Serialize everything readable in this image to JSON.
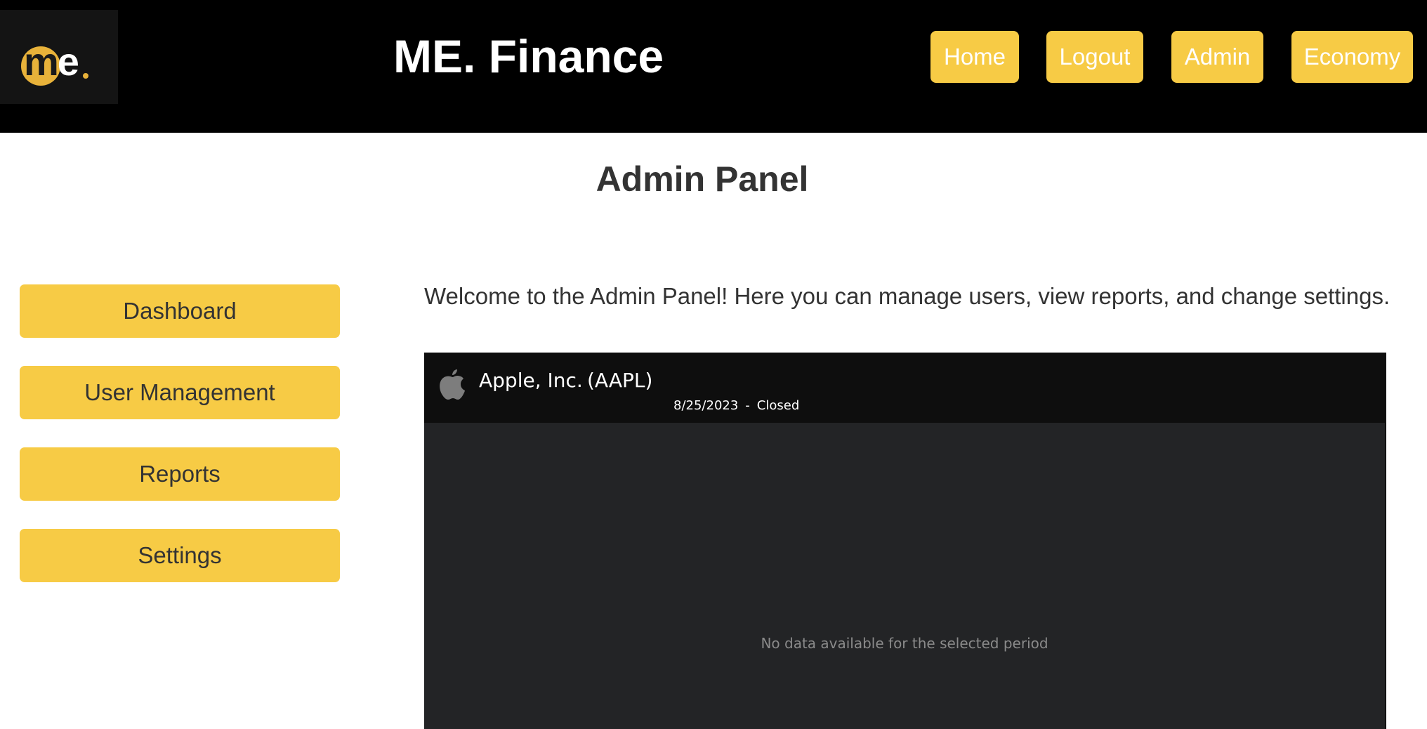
{
  "header": {
    "site_title": "ME. Finance",
    "logo": {
      "text_m": "m",
      "text_e": "e",
      "dot": "."
    },
    "nav": [
      {
        "label": "Home"
      },
      {
        "label": "Logout"
      },
      {
        "label": "Admin"
      },
      {
        "label": "Economy"
      }
    ]
  },
  "main": {
    "page_title": "Admin Panel",
    "welcome_text": "Welcome to the Admin Panel! Here you can manage users, view reports, and change settings."
  },
  "sidebar": {
    "items": [
      {
        "label": "Dashboard"
      },
      {
        "label": "User Management"
      },
      {
        "label": "Reports"
      },
      {
        "label": "Settings"
      }
    ]
  },
  "stock_widget": {
    "icon": "apple-logo-icon",
    "company_name": "Apple, Inc.",
    "ticker": "(AAPL)",
    "date": "8/25/2023",
    "separator": "-",
    "market_status": "Closed",
    "empty_message": "No data available for the selected period"
  },
  "colors": {
    "header_bg": "#000000",
    "accent_yellow": "#f7cb45",
    "logo_gold": "#e8b23a",
    "widget_bg": "#232426",
    "widget_header_bg": "#0e0e0e",
    "text_dark": "#333333"
  }
}
